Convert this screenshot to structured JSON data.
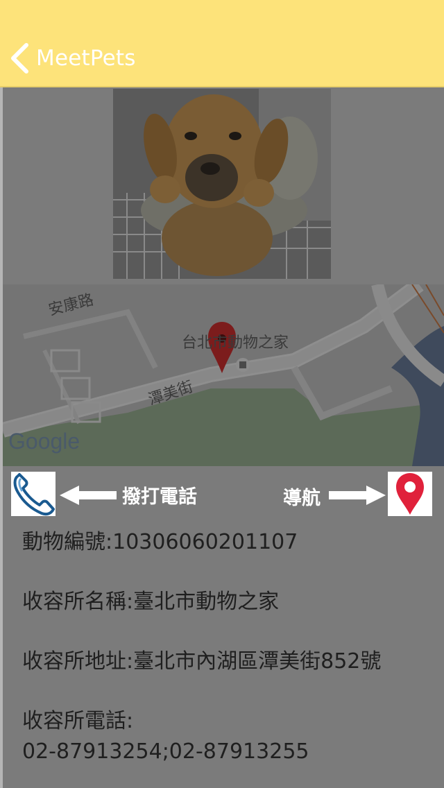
{
  "nav": {
    "back_label": "MeetPets",
    "bg_color": "#fde37a"
  },
  "actions": {
    "call_label": "撥打電話",
    "navigate_label": "導航",
    "phone_icon": "phone-icon",
    "pin_icon": "map-pin-icon",
    "pin_color": "#e0213b"
  },
  "map": {
    "place_label": "台北市動物之家",
    "road_1": "安康路",
    "road_2": "潭美街",
    "provider": "Google"
  },
  "info": {
    "animal_id_label": "動物編號:",
    "animal_id": "10306060201107",
    "shelter_name_label": "收容所名稱:",
    "shelter_name": "臺北市動物之家",
    "shelter_address_label": "收容所地址:",
    "shelter_address": "臺北市內湖區潭美街852號",
    "shelter_phone_label": "收容所電話:",
    "shelter_phone": "02-87913254;02-87913255"
  }
}
